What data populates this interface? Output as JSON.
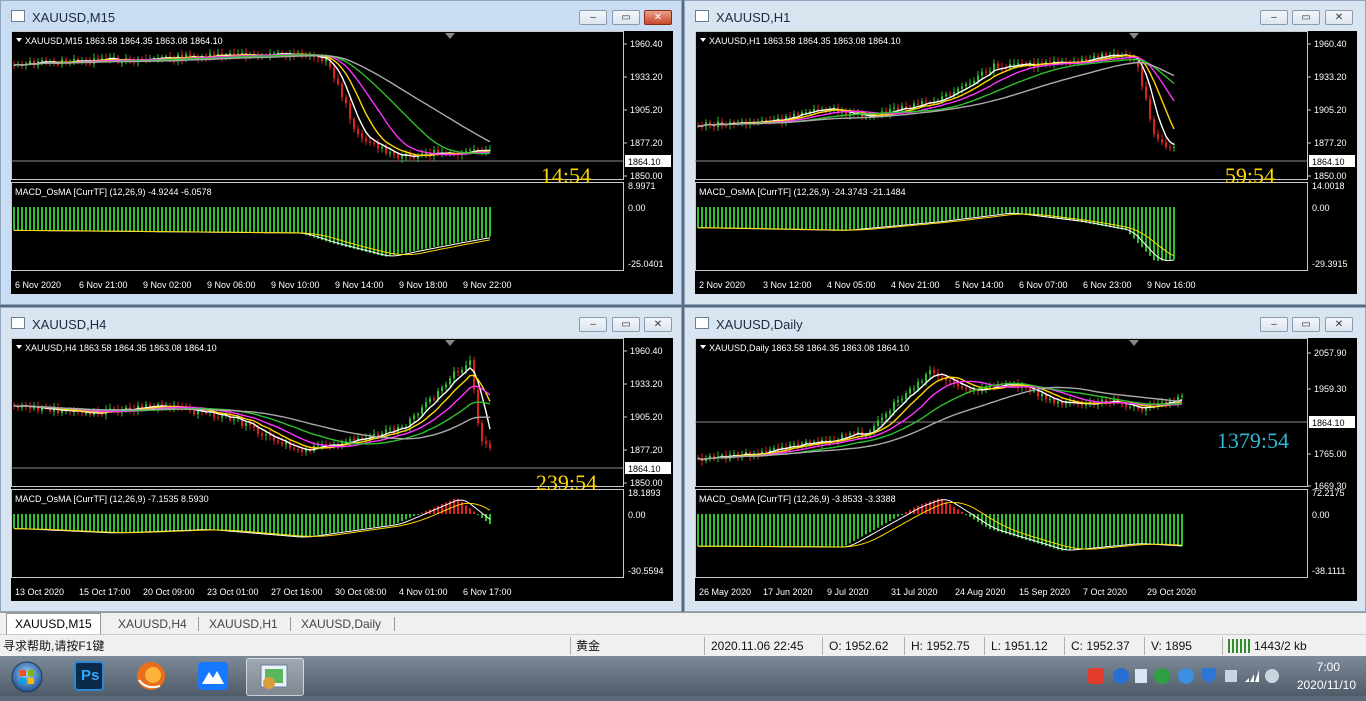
{
  "windows": [
    {
      "id": "m15",
      "title": "XAUUSD,M15",
      "info": "XAUUSD,M15  1863.58 1864.35 1863.08 1864.10",
      "price_labels": [
        "1960.40",
        "1933.20",
        "1905.20",
        "1877.20",
        "1850.00"
      ],
      "current_price": "1864.10",
      "countdown": "14:54",
      "countdown_color": "#ffd700",
      "macd_info": "MACD_OsMA [CurrTF] (12,26,9) -4.9244 -6.0578",
      "macd_labels": [
        "8.9971",
        "0.00",
        "-25.0401"
      ],
      "time_labels": [
        "6 Nov 2020",
        "6 Nov 21:00",
        "9 Nov 02:00",
        "9 Nov 06:00",
        "9 Nov 10:00",
        "9 Nov 14:00",
        "9 Nov 18:00",
        "9 Nov 22:00"
      ]
    },
    {
      "id": "h1",
      "title": "XAUUSD,H1",
      "info": "XAUUSD,H1  1863.58 1864.35 1863.08 1864.10",
      "price_labels": [
        "1960.40",
        "1933.20",
        "1905.20",
        "1877.20",
        "1850.00"
      ],
      "current_price": "1864.10",
      "countdown": "59:54",
      "countdown_color": "#ffd700",
      "macd_info": "MACD_OsMA [CurrTF] (12,26,9) -24.3743 -21.1484",
      "macd_labels": [
        "14.0018",
        "0.00",
        "-29.3915"
      ],
      "time_labels": [
        "2 Nov 2020",
        "3 Nov 12:00",
        "4 Nov 05:00",
        "4 Nov 21:00",
        "5 Nov 14:00",
        "6 Nov 07:00",
        "6 Nov 23:00",
        "9 Nov 16:00"
      ]
    },
    {
      "id": "h4",
      "title": "XAUUSD,H4",
      "info": "XAUUSD,H4  1863.58 1864.35 1863.08 1864.10",
      "price_labels": [
        "1960.40",
        "1933.20",
        "1905.20",
        "1877.20",
        "1850.00"
      ],
      "current_price": "1864.10",
      "countdown": "239:54",
      "countdown_color": "#ffd700",
      "macd_info": "MACD_OsMA [CurrTF] (12,26,9) -7.1535 8.5930",
      "macd_labels": [
        "18.1893",
        "0.00",
        "-30.5594"
      ],
      "time_labels": [
        "13 Oct 2020",
        "15 Oct 17:00",
        "20 Oct 09:00",
        "23 Oct 01:00",
        "27 Oct 16:00",
        "30 Oct 08:00",
        "4 Nov 01:00",
        "6 Nov 17:00"
      ]
    },
    {
      "id": "daily",
      "title": "XAUUSD,Daily",
      "info": "XAUUSD,Daily  1863.58 1864.35 1863.08 1864.10",
      "price_labels": [
        "2057.90",
        "1959.30",
        "1765.00",
        "1669.30"
      ],
      "current_price": "1864.10",
      "countdown": "1379:54",
      "countdown_color": "#2fb7d6",
      "macd_info": "MACD_OsMA [CurrTF] (12,26,9) -3.8533 -3.3388",
      "macd_labels": [
        "72.2175",
        "0.00",
        "-38.1111"
      ],
      "time_labels": [
        "26 May 2020",
        "17 Jun 2020",
        "9 Jul 2020",
        "31 Jul 2020",
        "24 Aug 2020",
        "15 Sep 2020",
        "7 Oct 2020",
        "29 Oct 2020"
      ]
    }
  ],
  "tabs": [
    "XAUUSD,M15",
    "XAUUSD,H4",
    "XAUUSD,H1",
    "XAUUSD,Daily"
  ],
  "status": {
    "help": "寻求帮助,请按F1键",
    "symbol_name": "黄金",
    "datetime": "2020.11.06 22:45",
    "open": "O: 1952.62",
    "high": "H: 1952.75",
    "low": "L: 1951.12",
    "close": "C: 1952.37",
    "volume": "V: 1895",
    "traffic": "1443/2 kb"
  },
  "window_buttons": {
    "minimize": "–",
    "restore": "▭",
    "close": "✕"
  },
  "taskbar": {
    "apps": [
      "start-orb-icon",
      "photoshop-icon",
      "firefox-icon",
      "cloud-app-icon",
      "metatrader-icon"
    ],
    "ps_label": "Ps",
    "time": "7:00",
    "date": "2020/11/10"
  }
}
